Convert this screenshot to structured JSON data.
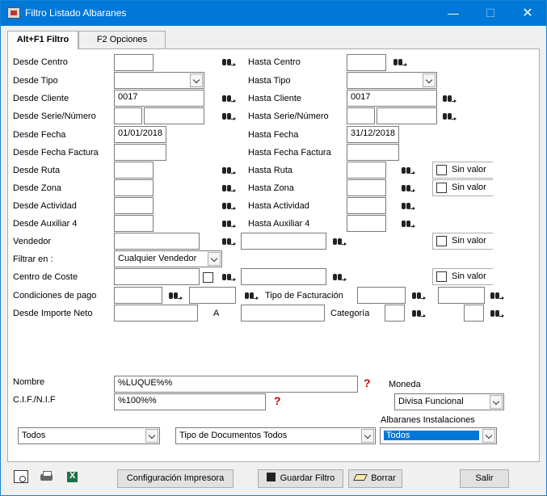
{
  "window": {
    "title": "Filtro Listado Albaranes"
  },
  "tabs": [
    {
      "label": "Alt+F1 Filtro"
    },
    {
      "label": "F2 Opciones"
    }
  ],
  "labels": {
    "desde_centro": "Desde Centro",
    "hasta_centro": "Hasta Centro",
    "desde_tipo": "Desde Tipo",
    "hasta_tipo": "Hasta Tipo",
    "desde_cliente": "Desde Cliente",
    "hasta_cliente": "Hasta Cliente",
    "desde_serie": "Desde Serie/Número",
    "hasta_serie": "Hasta Serie/Número",
    "desde_fecha": "Desde Fecha",
    "hasta_fecha": "Hasta Fecha",
    "desde_fecha_factura": "Desde Fecha Factura",
    "hasta_fecha_factura": "Hasta Fecha Factura",
    "desde_ruta": "Desde Ruta",
    "hasta_ruta": "Hasta Ruta",
    "desde_zona": "Desde Zona",
    "hasta_zona": "Hasta Zona",
    "desde_actividad": "Desde Actividad",
    "hasta_actividad": "Hasta Actividad",
    "desde_aux4": "Desde Auxiliar 4",
    "hasta_aux4": "Hasta Auxiliar 4",
    "vendedor": "Vendedor",
    "filtrar_en": "Filtrar en :",
    "centro_coste": "Centro de Coste",
    "condiciones_pago": "Condiciones de pago",
    "tipo_facturacion": "Tipo de Facturación",
    "desde_importe": "Desde Importe Neto",
    "a": "A",
    "categoria": "Categoría",
    "nombre": "Nombre",
    "cif": "C.I.F./N.I.F",
    "moneda": "Moneda",
    "albaranes_instalaciones": "Albaranes Instalaciones",
    "sin_valor": "Sin valor"
  },
  "values": {
    "desde_cliente": "0017",
    "hasta_cliente": "0017",
    "desde_fecha": "01/01/2018",
    "hasta_fecha": "31/12/2018",
    "filtrar_en": "Cualquier Vendedor",
    "nombre": "%LUQUE%%",
    "cif": "%100%%",
    "moneda": "Divisa Funcional",
    "todos1": "Todos",
    "tipo_documentos": "Tipo de Documentos Todos",
    "albaranes": "Todos"
  },
  "buttons": {
    "config": "Configuración Impresora",
    "guardar": "Guardar Filtro",
    "borrar": "Borrar",
    "salir": "Salir"
  },
  "colors": {
    "titlebar": "#0078d7",
    "selection": "#0078d7",
    "help_icon": "#cc0000"
  }
}
